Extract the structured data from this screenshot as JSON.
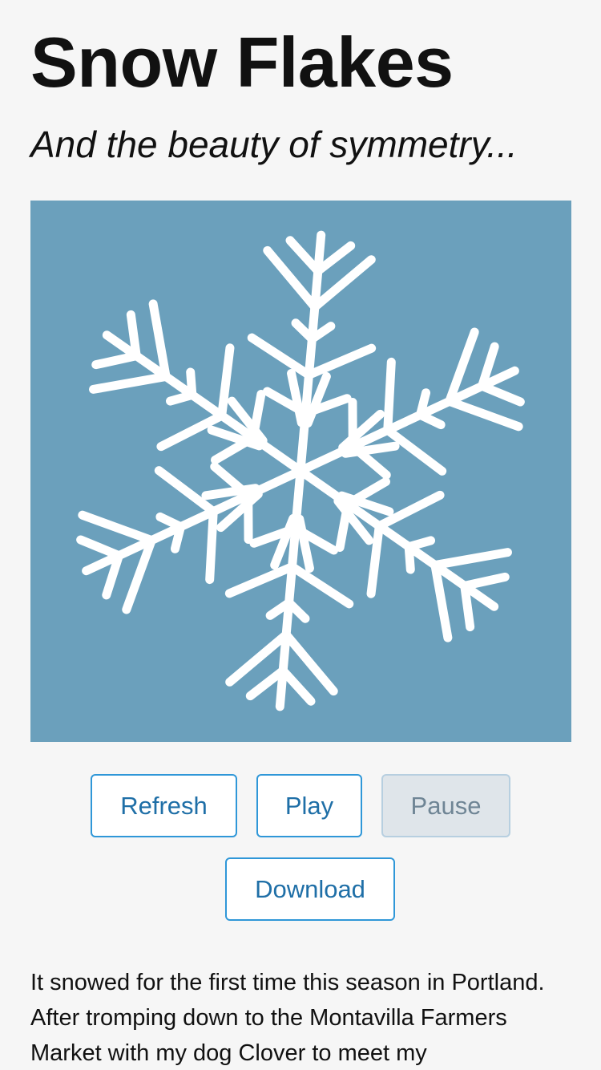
{
  "header": {
    "title": "Snow Flakes",
    "subtitle": "And the beauty of symmetry..."
  },
  "canvas": {
    "background_color": "#6ba0bc",
    "flake_color": "#ffffff",
    "arms": 6,
    "icon": "snowflake-graphic"
  },
  "controls": {
    "refresh_label": "Refresh",
    "play_label": "Play",
    "pause_label": "Pause",
    "pause_disabled": true,
    "download_label": "Download",
    "accent_color": "#2f97d8"
  },
  "article": {
    "text": "It snowed for the first time this season in Portland. After tromping down to the Montavilla Farmers Market with my dog Clover to meet my"
  }
}
